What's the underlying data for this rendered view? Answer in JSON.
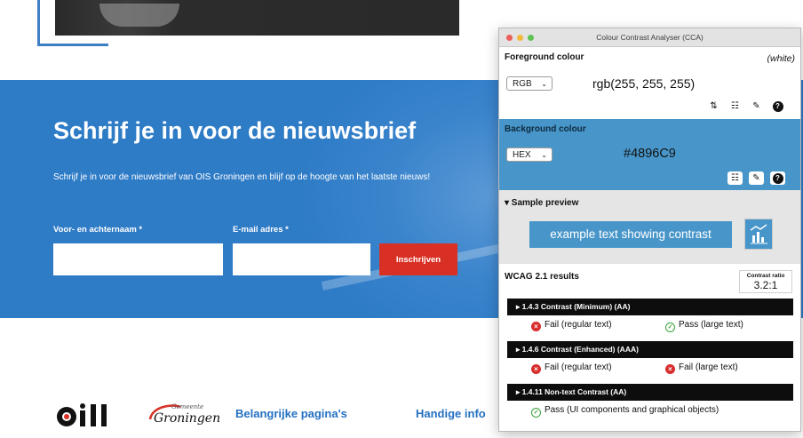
{
  "website": {
    "newsletter": {
      "title": "Schrijf je in voor de nieuwsbrief",
      "description": "Schrijf je in voor de nieuwsbrief van OIS Groningen en blijf op de hoogte van het laatste nieuws!",
      "name_label": "Voor- en achternaam *",
      "email_label": "E-mail adres *",
      "submit_label": "Inschrijven"
    },
    "footer": {
      "heading_1": "Belangrijke pagina's",
      "heading_2": "Handige info",
      "logo_gemeente_top": "Gemeente",
      "logo_gemeente_main": "Groningen"
    }
  },
  "cca": {
    "window_title": "Colour Contrast Analyser (CCA)",
    "foreground": {
      "label": "Foreground colour",
      "name": "(white)",
      "format": "RGB",
      "value": "rgb(255, 255, 255)"
    },
    "background": {
      "label": "Background colour",
      "format": "HEX",
      "value": "#4896C9"
    },
    "preview": {
      "label": "▾ Sample preview",
      "sample_text": "example text showing contrast"
    },
    "results": {
      "label": "WCAG 2.1 results",
      "ratio_caption": "Contrast ratio",
      "ratio_value": "3.2:1",
      "criteria": [
        {
          "title": "▸  1.4.3 Contrast (Minimum) (AA)",
          "left": "Fail (regular text)",
          "right": "Pass (large text)"
        },
        {
          "title": "▸  1.4.6 Contrast (Enhanced) (AAA)",
          "left": "Fail (regular text)",
          "right": "Fail (large text)"
        },
        {
          "title": "▸  1.4.11 Non-text Contrast (AA)",
          "left": "Pass (UI components and graphical objects)"
        }
      ]
    },
    "colors": {
      "sample_bg": "#4896C9",
      "fail": "#d92e2e",
      "pass": "#3aa33a"
    }
  }
}
